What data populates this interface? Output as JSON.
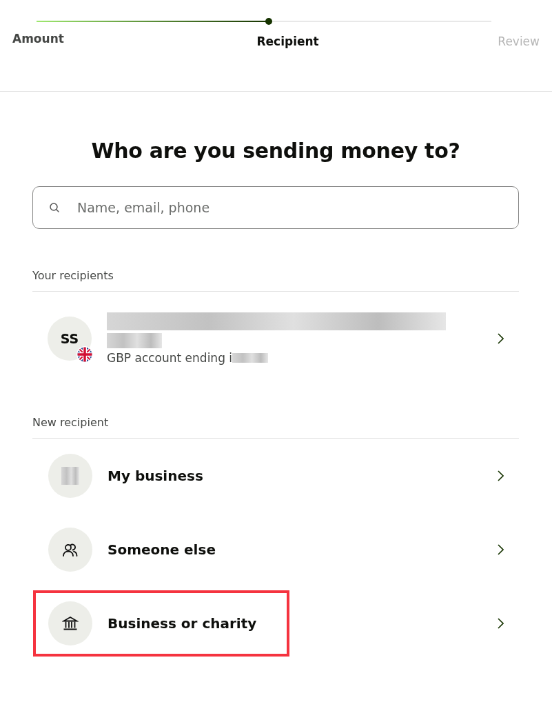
{
  "stepper": {
    "level": 0.51,
    "steps": [
      {
        "label": "Amount",
        "kind": "done"
      },
      {
        "label": "Recipient",
        "kind": "current"
      },
      {
        "label": "Review",
        "kind": "upcoming"
      }
    ]
  },
  "heading": "Who are you sending money to?",
  "search": {
    "placeholder": "Name, email, phone"
  },
  "your_recipients": {
    "title": "Your recipients",
    "items": [
      {
        "initials": "SS",
        "detail": "GBP account ending i",
        "flag": true,
        "redacted": true
      }
    ]
  },
  "new_recipient": {
    "title": "New recipient",
    "items": [
      {
        "label": "My business",
        "kind": "redacted",
        "highlighted": false
      },
      {
        "label": "Someone else",
        "kind": "people",
        "highlighted": false
      },
      {
        "label": "Business or charity",
        "kind": "bank",
        "highlighted": true
      }
    ]
  }
}
